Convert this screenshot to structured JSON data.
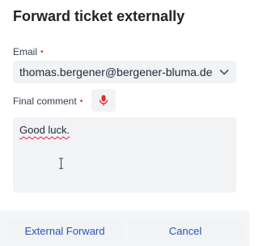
{
  "dialog": {
    "title": "Forward ticket externally"
  },
  "email": {
    "label": "Email",
    "required_mark": "•",
    "value": "thomas.bergener@bergener-bluma.de",
    "dropdown_icon": "chevron-down-icon"
  },
  "comment": {
    "label": "Final comment",
    "required_mark": "•",
    "mic_icon": "microphone-icon",
    "value": "Good luck."
  },
  "buttons": {
    "forward_label": "External Forward",
    "cancel_label": "Cancel"
  },
  "colors": {
    "required": "#dc2626",
    "mic": "#d93025",
    "button_text": "#2456b6",
    "field_bg": "#f1f3f5"
  }
}
